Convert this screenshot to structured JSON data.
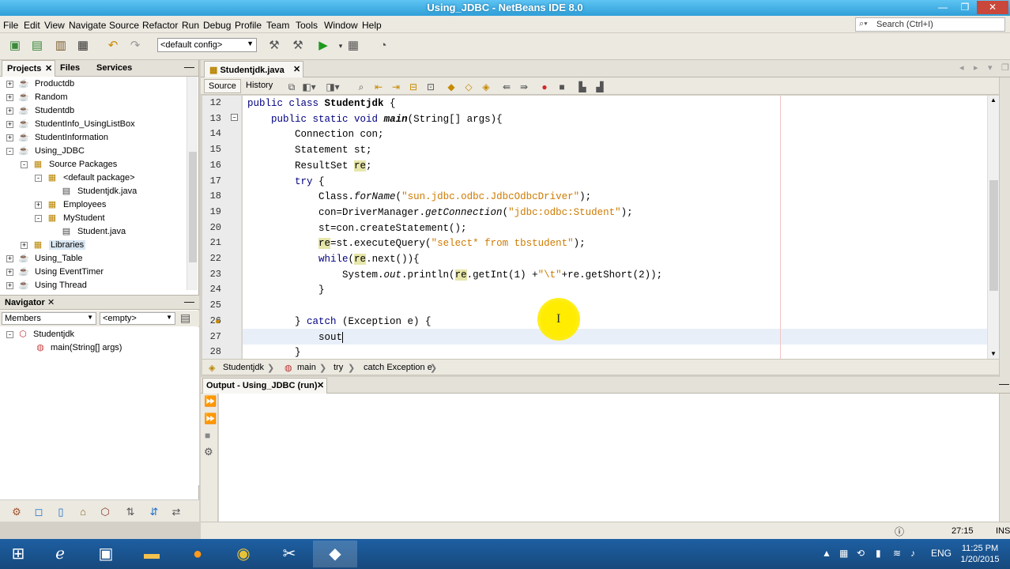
{
  "window": {
    "title": "Using_JDBC - NetBeans IDE 8.0",
    "minimize": "—",
    "maximize": "❐",
    "close": "✕"
  },
  "menu": [
    "File",
    "Edit",
    "View",
    "Navigate",
    "Source",
    "Refactor",
    "Run",
    "Debug",
    "Profile",
    "Team",
    "Tools",
    "Window",
    "Help"
  ],
  "search": {
    "placeholder": "Search (Ctrl+I)"
  },
  "toolbar": {
    "config": "<default config>"
  },
  "projects_panel": {
    "tabs": [
      "Projects",
      "Files",
      "Services"
    ],
    "tree": [
      {
        "label": "Productdb",
        "indent": 0,
        "exp": "+",
        "icon": "project"
      },
      {
        "label": "Random",
        "indent": 0,
        "exp": "+",
        "icon": "project"
      },
      {
        "label": "Studentdb",
        "indent": 0,
        "exp": "+",
        "icon": "project"
      },
      {
        "label": "StudentInfo_UsingListBox",
        "indent": 0,
        "exp": "+",
        "icon": "project"
      },
      {
        "label": "StudentInformation",
        "indent": 0,
        "exp": "+",
        "icon": "project"
      },
      {
        "label": "Using_JDBC",
        "indent": 0,
        "exp": "-",
        "icon": "project"
      },
      {
        "label": "Source Packages",
        "indent": 1,
        "exp": "-",
        "icon": "package"
      },
      {
        "label": "<default package>",
        "indent": 2,
        "exp": "-",
        "icon": "package"
      },
      {
        "label": "Studentjdk.java",
        "indent": 3,
        "exp": "",
        "icon": "file"
      },
      {
        "label": "Employees",
        "indent": 2,
        "exp": "+",
        "icon": "package"
      },
      {
        "label": "MyStudent",
        "indent": 2,
        "exp": "-",
        "icon": "package"
      },
      {
        "label": "Student.java",
        "indent": 3,
        "exp": "",
        "icon": "file"
      },
      {
        "label": "Libraries",
        "indent": 1,
        "exp": "+",
        "icon": "package"
      },
      {
        "label": "Using_Table",
        "indent": 0,
        "exp": "+",
        "icon": "project"
      },
      {
        "label": "Using EventTimer",
        "indent": 0,
        "exp": "+",
        "icon": "project"
      },
      {
        "label": "Using Thread",
        "indent": 0,
        "exp": "+",
        "icon": "project"
      }
    ]
  },
  "navigator": {
    "title": "Navigator",
    "members": "Members",
    "filter": "<empty>",
    "tree": [
      {
        "label": "Studentjdk",
        "indent": 0
      },
      {
        "label": "main(String[] args)",
        "indent": 1
      }
    ]
  },
  "editor": {
    "tab": "Studentjdk.java",
    "source_btn": "Source",
    "history_btn": "History",
    "lines": [
      {
        "n": "12",
        "html": "<span class='kw'>public class</span> <span class='bold'>Studentjdk</span> {"
      },
      {
        "n": "13",
        "html": "    <span class='kw'>public static void</span> <span class='it bold'>main</span>(String[] args){"
      },
      {
        "n": "14",
        "html": "        Connection con;"
      },
      {
        "n": "15",
        "html": "        Statement st;"
      },
      {
        "n": "16",
        "html": "        ResultSet <span class='hl'>re</span>;"
      },
      {
        "n": "17",
        "html": "        <span class='kw'>try</span> {"
      },
      {
        "n": "18",
        "html": "            Class.<span class='it'>forName</span>(<span class='str'>\"sun.jdbc.odbc.JdbcOdbcDriver\"</span>);"
      },
      {
        "n": "19",
        "html": "            con=DriverManager.<span class='it'>getConnection</span>(<span class='str'>\"jdbc:odbc:Student\"</span>);"
      },
      {
        "n": "20",
        "html": "            st=con.createStatement();"
      },
      {
        "n": "21",
        "html": "            <span class='hl'>re</span>=st.executeQuery(<span class='str'>\"select* from tbstudent\"</span>);"
      },
      {
        "n": "22",
        "html": "            <span class='kw'>while</span>(<span class='hl'>re</span>.next()){"
      },
      {
        "n": "23",
        "html": "                System.<span class='it'>out</span>.println(<span class='hl'>re</span>.getInt(1) +<span class='str'>\"\\t\"</span>+re.getShort(2));"
      },
      {
        "n": "24",
        "html": "            }"
      },
      {
        "n": "25",
        "html": ""
      },
      {
        "n": "26",
        "html": "        } <span class='kw'>catch</span> (Exception e) {"
      },
      {
        "n": "27",
        "html": "            sout"
      },
      {
        "n": "28",
        "html": "        }"
      }
    ],
    "breadcrumb": [
      "Studentjdk",
      "main",
      "try",
      "catch Exception e"
    ]
  },
  "output": {
    "tab": "Output - Using_JDBC (run)"
  },
  "status": {
    "position": "27:15",
    "mode": "INS"
  },
  "taskbar": {
    "lang": "ENG",
    "time": "11:25 PM",
    "date": "1/20/2015"
  }
}
